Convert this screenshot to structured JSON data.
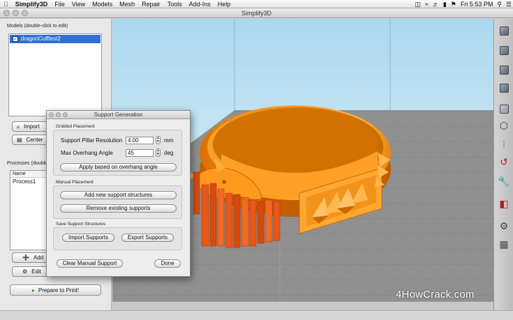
{
  "menubar": {
    "app_name": "Simplify3D",
    "items": [
      "File",
      "View",
      "Models",
      "Mesh",
      "Repair",
      "Tools",
      "Add-Ins",
      "Help"
    ],
    "clock": "Fri 5:53 PM",
    "battery_icon": "battery-icon",
    "wifi_icon": "wifi-icon"
  },
  "window": {
    "title": "Simplify3D"
  },
  "models": {
    "label": "Models (double-click to edit)",
    "items": [
      {
        "name": "dragonCufftest2",
        "checked": true
      }
    ],
    "import_label": "Import",
    "center_label": "Center"
  },
  "processes": {
    "label": "Processes (double",
    "column_header": "Name",
    "items": [
      "Process1"
    ],
    "add_label": "Add",
    "edit_label": "Edit"
  },
  "prepare_label": "Prepare to Print!",
  "dialog": {
    "title": "Support Generation",
    "gridded": {
      "label": "Gridded Placement",
      "pillar_label": "Support Pillar Resolution",
      "pillar_value": "4.00",
      "pillar_unit": "mm",
      "overhang_label": "Max Overhang Angle",
      "overhang_value": "45",
      "overhang_unit": "deg",
      "apply_label": "Apply based on overhang angle"
    },
    "manual": {
      "label": "Manual Placement",
      "add_label": "Add new support structures",
      "remove_label": "Remove existing supports"
    },
    "save": {
      "label": "Save Support Structures",
      "import_label": "Import Supports",
      "export_label": "Export Supports"
    },
    "clear_label": "Clear Manual Support",
    "done_label": "Done"
  },
  "toolbar_icons": [
    "iso-view-icon",
    "front-view-icon",
    "top-view-icon",
    "side-view-icon",
    "solid-view-icon",
    "wireframe-icon",
    "points-icon",
    "axes-icon",
    "wrench-icon",
    "cross-section-icon",
    "gear-icon",
    "bin-icon"
  ],
  "colors": {
    "model": "#ff9a1e",
    "support": "#e64a12",
    "bed": "#8f8f8f",
    "selection": "#2e6fd9"
  },
  "watermark": "4HowCrack.com"
}
